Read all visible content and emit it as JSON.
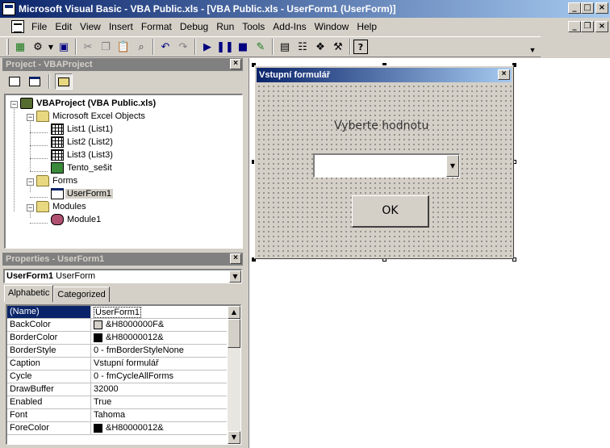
{
  "window": {
    "title": "Microsoft Visual Basic - VBA Public.xls - [VBA Public.xls - UserForm1 (UserForm)]"
  },
  "menu": {
    "items": [
      "File",
      "Edit",
      "View",
      "Insert",
      "Format",
      "Debug",
      "Run",
      "Tools",
      "Add-Ins",
      "Window",
      "Help"
    ]
  },
  "project": {
    "title": "Project - VBAProject",
    "root": "VBAProject (VBA Public.xls)",
    "excel_objects": "Microsoft Excel Objects",
    "sheets": [
      "List1 (List1)",
      "List2 (List2)",
      "List3 (List3)",
      "Tento_sešit"
    ],
    "forms": "Forms",
    "form1": "UserForm1",
    "modules": "Modules",
    "module1": "Module1"
  },
  "properties": {
    "title": "Properties - UserForm1",
    "object_name": "UserForm1",
    "object_type": "UserForm",
    "tabs": [
      "Alphabetic",
      "Categorized"
    ],
    "rows": [
      {
        "name": "(Name)",
        "value": "UserForm1"
      },
      {
        "name": "BackColor",
        "value": "&H8000000F&",
        "color": "#d4d0c8"
      },
      {
        "name": "BorderColor",
        "value": "&H80000012&",
        "color": "#000000"
      },
      {
        "name": "BorderStyle",
        "value": "0 - fmBorderStyleNone"
      },
      {
        "name": "Caption",
        "value": "Vstupní formulář"
      },
      {
        "name": "Cycle",
        "value": "0 - fmCycleAllForms"
      },
      {
        "name": "DrawBuffer",
        "value": "32000"
      },
      {
        "name": "Enabled",
        "value": "True"
      },
      {
        "name": "Font",
        "value": "Tahoma"
      },
      {
        "name": "ForeColor",
        "value": "&H80000012&",
        "color": "#000000"
      }
    ]
  },
  "userform": {
    "caption": "Vstupní formulář",
    "label": "Vyberte hodnotu",
    "ok_label": "OK"
  },
  "colors": {
    "titlebar": "#0a246a",
    "face": "#d4d0c8"
  }
}
